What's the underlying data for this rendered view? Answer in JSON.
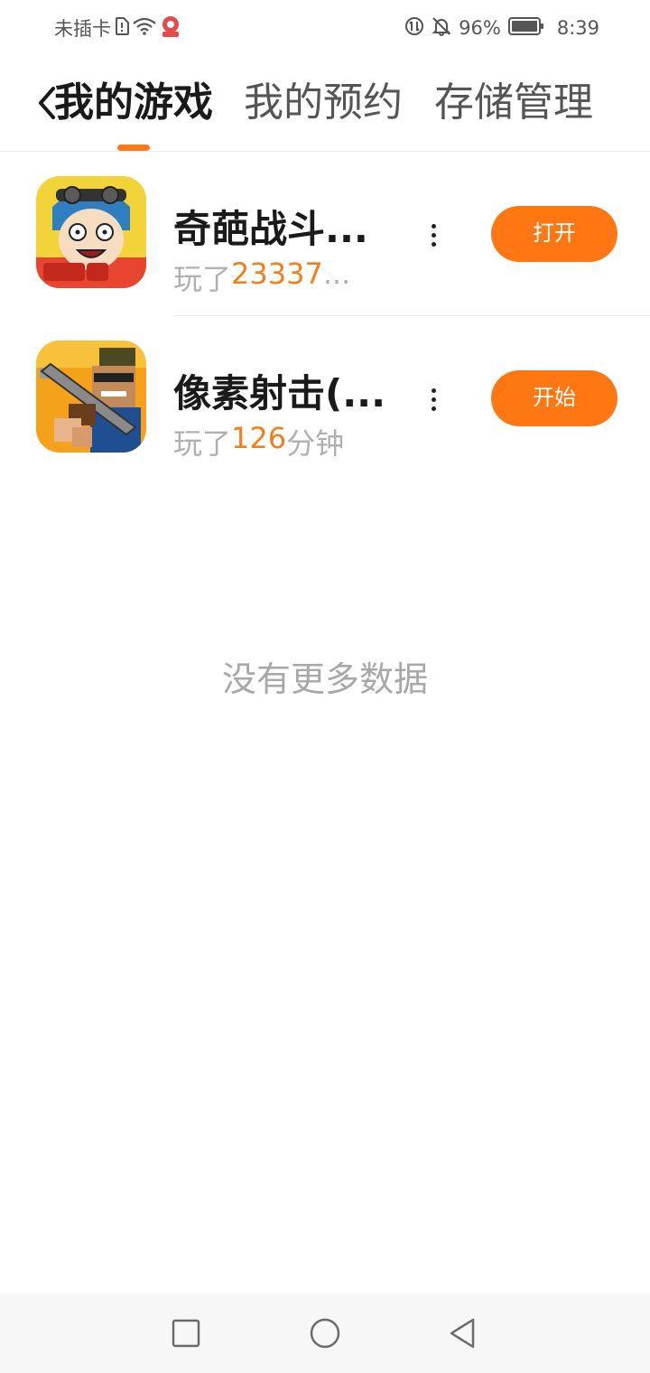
{
  "status_bar": {
    "carrier": "未插卡",
    "battery": "96%",
    "time": "8:39",
    "icons": [
      "sim-alert-icon",
      "wifi-icon",
      "app-notification-icon",
      "data-saver-icon",
      "mute-bell-icon",
      "battery-icon"
    ]
  },
  "header": {
    "back_icon": "chevron-left-icon",
    "tabs": [
      {
        "label": "我的游戏",
        "active": true
      },
      {
        "label": "我的预约",
        "active": false
      },
      {
        "label": "存储管理",
        "active": false
      }
    ]
  },
  "games": [
    {
      "title": "奇葩战斗...",
      "play_prefix": "玩了",
      "play_value": "23337",
      "play_suffix": "...",
      "action": "打开",
      "icon": "cartoon-boy-game-icon"
    },
    {
      "title": "像素射击(...",
      "play_prefix": "玩了",
      "play_value": "126",
      "play_suffix": "分钟",
      "action": "开始",
      "icon": "pixel-shooter-game-icon"
    }
  ],
  "footer_text": "没有更多数据",
  "nav_bar": {
    "icons": [
      "recent-apps-icon",
      "home-icon",
      "back-icon"
    ]
  },
  "colors": {
    "accent": "#ff7713",
    "play_number": "#f27f1e",
    "muted_text": "#b0b0b0"
  }
}
